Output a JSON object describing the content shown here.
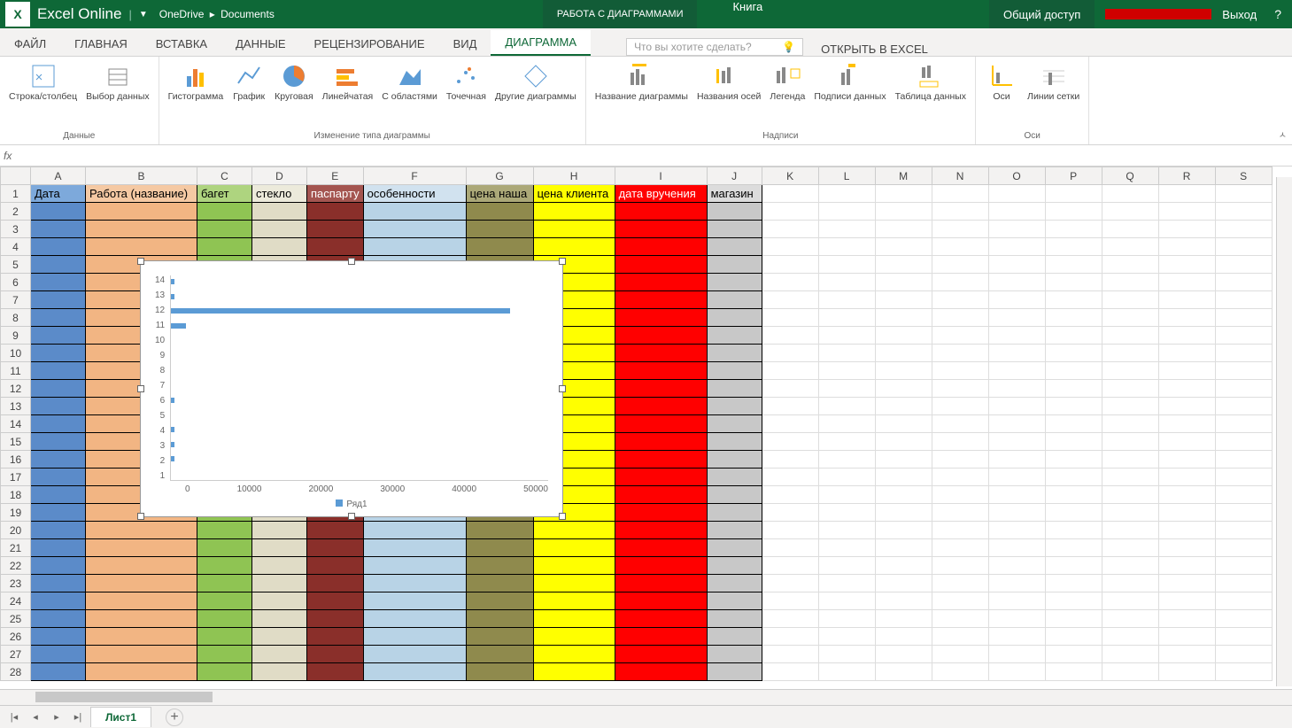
{
  "topbar": {
    "app_name": "Excel Online",
    "breadcrumb_root": "OneDrive",
    "breadcrumb_folder": "Documents",
    "chart_tools": "РАБОТА С ДИАГРАММАМИ",
    "filename": "Книга",
    "share": "Общий доступ",
    "signout": "Выход"
  },
  "tabs": {
    "file": "ФАЙЛ",
    "home": "ГЛАВНАЯ",
    "insert": "ВСТАВКА",
    "data": "ДАННЫЕ",
    "review": "РЕЦЕНЗИРОВАНИЕ",
    "view": "ВИД",
    "chart": "ДИАГРАММА",
    "tellme_placeholder": "Что вы хотите сделать?",
    "open_excel": "ОТКРЫТЬ В EXCEL"
  },
  "ribbon": {
    "data_group": "Данные",
    "switch_rc": "Строка/столбец",
    "select_data": "Выбор данных",
    "change_type_group": "Изменение типа диаграммы",
    "column": "Гистограмма",
    "line": "График",
    "pie": "Круговая",
    "bar": "Линейчатая",
    "area": "С областями",
    "scatter": "Точечная",
    "other": "Другие диаграммы",
    "labels_group": "Надписи",
    "chart_title": "Название диаграммы",
    "axis_titles": "Названия осей",
    "legend": "Легенда",
    "data_labels": "Подписи данных",
    "data_table": "Таблица данных",
    "axes_group": "Оси",
    "axes": "Оси",
    "gridlines": "Линии сетки"
  },
  "headers": {
    "A": "Дата",
    "B": "Работа (название)",
    "C": "багет",
    "D": "стекло",
    "E": "паспарту",
    "F": "особенности",
    "G": "цена наша",
    "H": "цена клиента",
    "I": "дата вручения",
    "J": "магазин"
  },
  "columns": [
    "A",
    "B",
    "C",
    "D",
    "E",
    "F",
    "G",
    "H",
    "I",
    "J",
    "K",
    "L",
    "M",
    "N",
    "O",
    "P",
    "Q",
    "R",
    "S"
  ],
  "col_widths": {
    "A": 62,
    "B": 126,
    "C": 62,
    "D": 62,
    "E": 62,
    "F": 116,
    "G": 76,
    "H": 92,
    "I": 104,
    "J": 62
  },
  "col_colors": {
    "A": "#5b8bc9",
    "B": "#f2b583",
    "C": "#8fc453",
    "D": "#e0dcc6",
    "E": "#8a2f2a",
    "F": "#b8d3e6",
    "G": "#8f8a4d",
    "H": "#ffff00",
    "I": "#ff0000",
    "J": "#c8c8c8"
  },
  "header_colors": {
    "A": "#7da9db",
    "B": "#f5c9a3",
    "C": "#aed47f",
    "D": "#eceadb",
    "E": "#a45550",
    "F": "#d1e2ef",
    "G": "#aba878",
    "H": "#ffff00",
    "I": "#ff0000",
    "J": "#dcdcdc"
  },
  "row_count": 28,
  "chart_data": {
    "type": "bar",
    "categories": [
      1,
      2,
      3,
      4,
      5,
      6,
      7,
      8,
      9,
      10,
      11,
      12,
      13,
      14
    ],
    "values": [
      0,
      500,
      500,
      500,
      0,
      500,
      0,
      0,
      0,
      0,
      2000,
      45000,
      500,
      500
    ],
    "series_name": "Ряд1",
    "xlim": [
      0,
      50000
    ],
    "xticks": [
      0,
      10000,
      20000,
      30000,
      40000,
      50000
    ]
  },
  "sheet": {
    "name": "Лист1"
  }
}
